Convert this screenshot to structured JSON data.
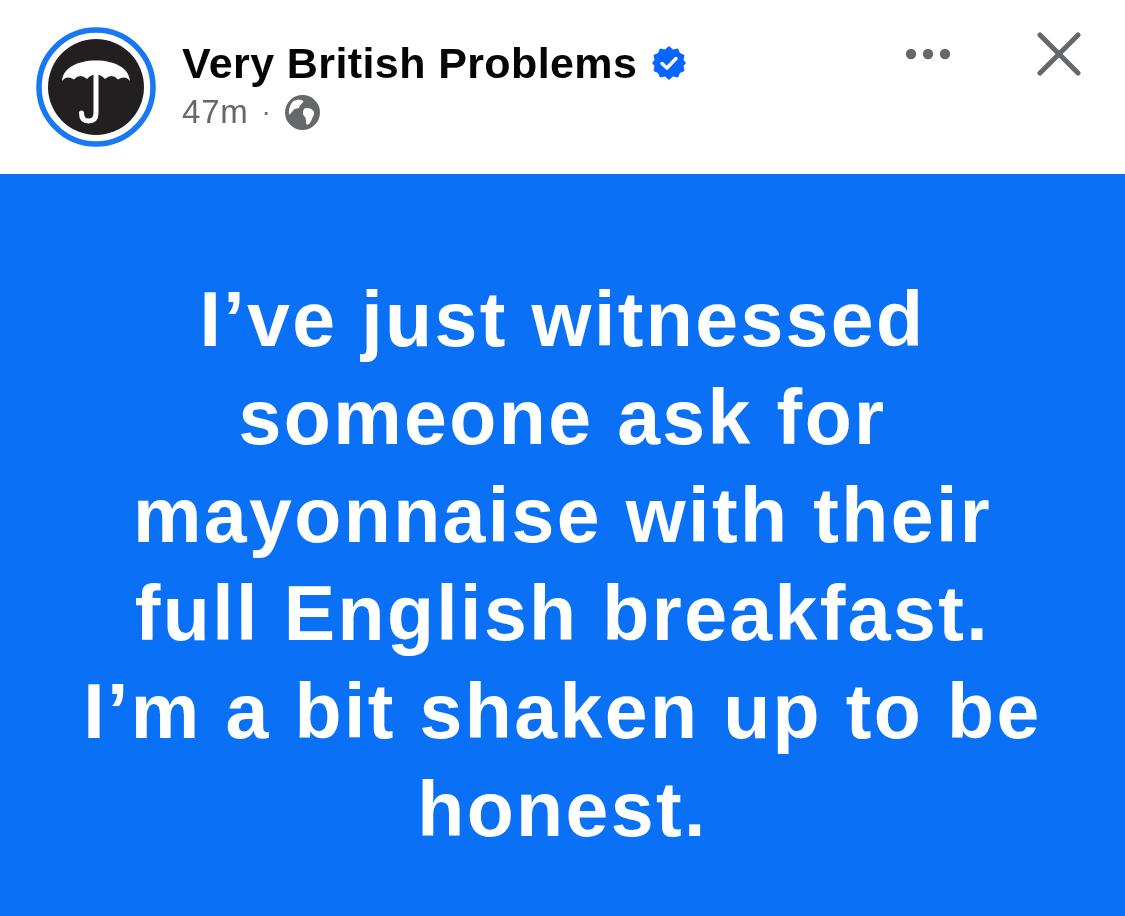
{
  "post": {
    "avatar": {
      "story_ring": true
    },
    "author": "Very British Problems",
    "verified": true,
    "time": "47m",
    "separator": "·",
    "audience": {
      "kind": "public"
    }
  },
  "body": {
    "text": "I’ve just witnessed someone ask for mayonnaise with their full English breakfast. I’m a bit shaken up to be honest."
  }
}
